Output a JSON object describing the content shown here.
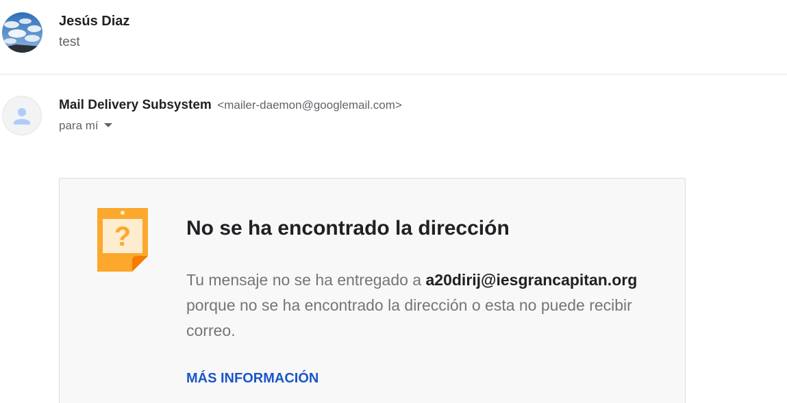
{
  "thread": {
    "collapsed_message": {
      "sender": "Jesús Diaz",
      "snippet": "test",
      "avatar_icon": "sky-photo-avatar"
    },
    "expanded_message": {
      "sender_name": "Mail Delivery Subsystem",
      "sender_email": "<mailer-daemon@googlemail.com>",
      "recipient_label": "para mí",
      "avatar_icon": "default-person-avatar"
    }
  },
  "bounce_card": {
    "icon": "question-mark-note-icon",
    "title": "No se ha encontrado la dirección",
    "body_prefix": "Tu mensaje no se ha entregado a ",
    "address": "a20dirij@iesgrancapitan.org",
    "body_suffix": "porque no se ha encontrado la dirección o esta no puede recibir correo.",
    "link_label": "MÁS INFORMACIÓN"
  },
  "colors": {
    "link": "#1a56c9",
    "note_orange": "#fba82d",
    "note_inner": "#fdeccd",
    "avatar_default": "#aecbfa"
  }
}
